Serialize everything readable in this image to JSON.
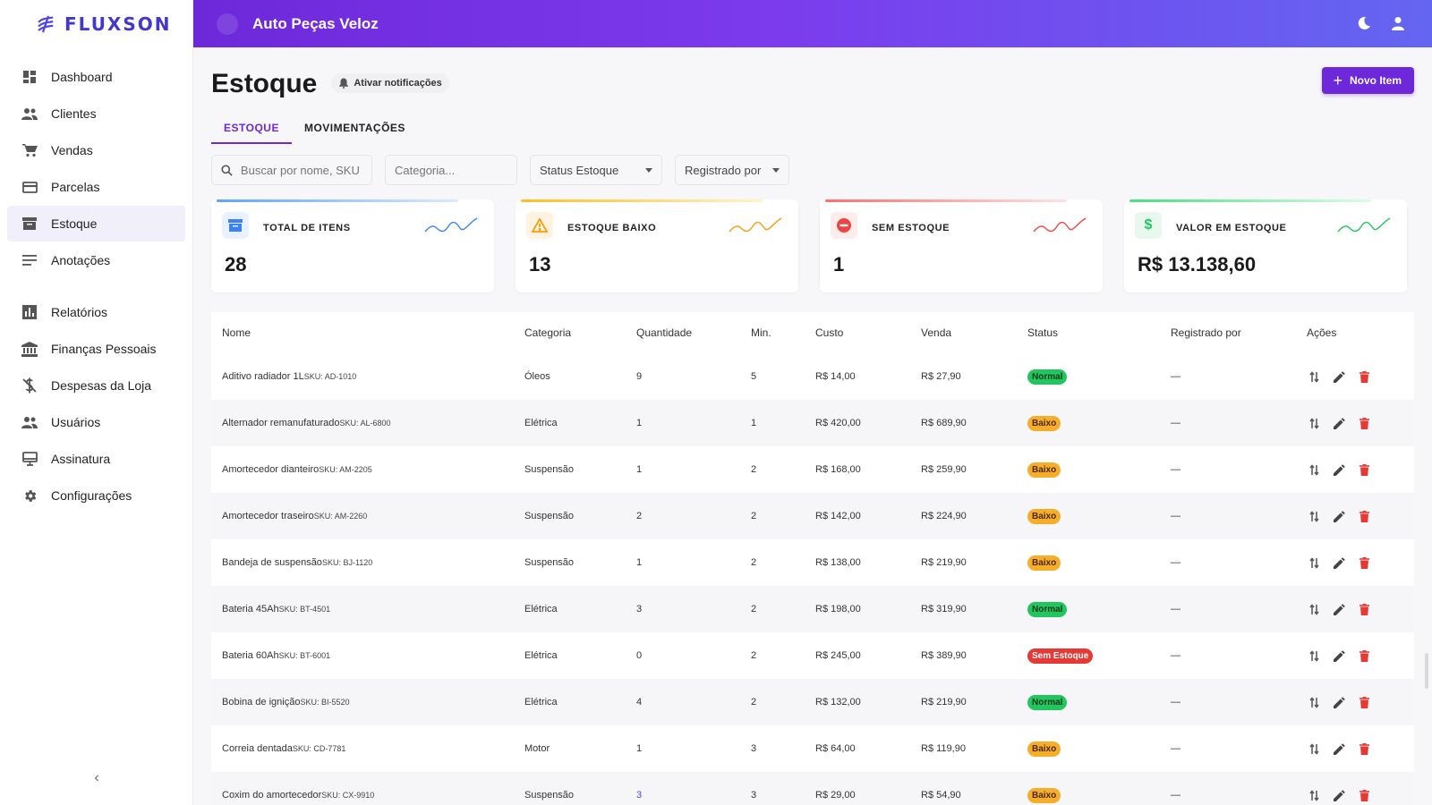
{
  "sidebar": {
    "logo_text": "FLUXSON",
    "items": [
      {
        "label": "Dashboard",
        "icon": "dashboard-icon"
      },
      {
        "label": "Clientes",
        "icon": "people-icon"
      },
      {
        "label": "Vendas",
        "icon": "cart-icon"
      },
      {
        "label": "Parcelas",
        "icon": "credit-card-icon"
      },
      {
        "label": "Estoque",
        "icon": "inventory-icon",
        "active": true
      },
      {
        "label": "Anotações",
        "icon": "notes-icon"
      }
    ],
    "items2": [
      {
        "label": "Relatórios",
        "icon": "bar-chart-icon"
      },
      {
        "label": "Finanças Pessoais",
        "icon": "bank-icon"
      },
      {
        "label": "Despesas da Loja",
        "icon": "money-off-icon"
      },
      {
        "label": "Usuários",
        "icon": "group-icon"
      },
      {
        "label": "Assinatura",
        "icon": "monitor-icon"
      },
      {
        "label": "Configurações",
        "icon": "gear-icon"
      }
    ],
    "collapse_glyph": "‹"
  },
  "topbar": {
    "store_name": "Auto Peças Veloz"
  },
  "page": {
    "title": "Estoque",
    "notif_label": "Ativar notificações",
    "new_item_label": "Novo Item"
  },
  "tabs": [
    "ESTOQUE",
    "MOVIMENTAÇÕES"
  ],
  "filters": {
    "search_placeholder": "Buscar por nome, SKU",
    "category_placeholder": "Categoria...",
    "status_label": "Status Estoque",
    "registered_label": "Registrado por"
  },
  "cards": [
    {
      "label": "TOTAL DE ITENS",
      "value": "28",
      "color": "#3b82f6"
    },
    {
      "label": "ESTOQUE BAIXO",
      "value": "13",
      "color": "#f59e0b"
    },
    {
      "label": "SEM ESTOQUE",
      "value": "1",
      "color": "#ef4444"
    },
    {
      "label": "VALOR EM ESTOQUE",
      "value": "R$ 13.138,60",
      "color": "#22c55e"
    }
  ],
  "table": {
    "headers": [
      "Nome",
      "Categoria",
      "Quantidade",
      "Min.",
      "Custo",
      "Venda",
      "Status",
      "Registrado por",
      "Ações"
    ],
    "rows": [
      {
        "name": "Aditivo radiador 1L",
        "sku": "SKU: AD-1010",
        "category": "Óleos",
        "qty": "9",
        "min": "5",
        "cost": "R$ 14,00",
        "price": "R$ 27,90",
        "status": "Normal",
        "reg": "—"
      },
      {
        "name": "Alternador remanufaturado",
        "sku": "SKU: AL-6800",
        "category": "Elétrica",
        "qty": "1",
        "min": "1",
        "cost": "R$ 420,00",
        "price": "R$ 689,90",
        "status": "Baixo",
        "reg": "—"
      },
      {
        "name": "Amortecedor dianteiro",
        "sku": "SKU: AM-2205",
        "category": "Suspensão",
        "qty": "1",
        "min": "2",
        "cost": "R$ 168,00",
        "price": "R$ 259,90",
        "status": "Baixo",
        "reg": "—"
      },
      {
        "name": "Amortecedor traseiro",
        "sku": "SKU: AM-2260",
        "category": "Suspensão",
        "qty": "2",
        "min": "2",
        "cost": "R$ 142,00",
        "price": "R$ 224,90",
        "status": "Baixo",
        "reg": "—"
      },
      {
        "name": "Bandeja de suspensão",
        "sku": "SKU: BJ-1120",
        "category": "Suspensão",
        "qty": "1",
        "min": "2",
        "cost": "R$ 138,00",
        "price": "R$ 219,90",
        "status": "Baixo",
        "reg": "—"
      },
      {
        "name": "Bateria 45Ah",
        "sku": "SKU: BT-4501",
        "category": "Elétrica",
        "qty": "3",
        "min": "2",
        "cost": "R$ 198,00",
        "price": "R$ 319,90",
        "status": "Normal",
        "reg": "—"
      },
      {
        "name": "Bateria 60Ah",
        "sku": "SKU: BT-6001",
        "category": "Elétrica",
        "qty": "0",
        "min": "2",
        "cost": "R$ 245,00",
        "price": "R$ 389,90",
        "status": "Sem Estoque",
        "reg": "—"
      },
      {
        "name": "Bobina de ignição",
        "sku": "SKU: BI-5520",
        "category": "Elétrica",
        "qty": "4",
        "min": "2",
        "cost": "R$ 132,00",
        "price": "R$ 219,90",
        "status": "Normal",
        "reg": "—"
      },
      {
        "name": "Correia dentada",
        "sku": "SKU: CD-7781",
        "category": "Motor",
        "qty": "1",
        "min": "3",
        "cost": "R$ 64,00",
        "price": "R$ 119,90",
        "status": "Baixo",
        "reg": "—"
      },
      {
        "name": "Coxim do amortecedor",
        "sku": "SKU: CX-9910",
        "category": "Suspensão",
        "qty": "3",
        "min": "3",
        "cost": "R$ 29,00",
        "price": "R$ 54,90",
        "status": "Baixo",
        "reg": "—"
      }
    ]
  }
}
